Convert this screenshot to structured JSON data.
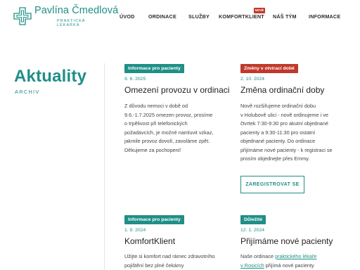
{
  "brand": {
    "name": "Pavlína Čmedlová",
    "subtitle_line1": "Praktická",
    "subtitle_line2": "lékařka",
    "color": "#1f8f87"
  },
  "nav": {
    "items": [
      {
        "label": "Úvod"
      },
      {
        "label": "Ordinace"
      },
      {
        "label": "Služby"
      },
      {
        "label": "KomfortKlient"
      },
      {
        "label": "Náš tým"
      },
      {
        "label": "Informace"
      }
    ],
    "new_badge": "Nové"
  },
  "page": {
    "title": "Aktuality",
    "archive_label": "Archiv"
  },
  "news": [
    {
      "category": "Informace pro pacienty",
      "category_color": "#1f8f87",
      "date": "9. 6. 2025",
      "title": "Omezení provozu v ordinaci",
      "body": [
        "Z důvodu nemoci v době od",
        "9.6.-1.7.2025 omezen provoz, prosíme",
        "o trpělivost při telefonických",
        "požadavcích, je možné namluvit vzkaz,",
        "jakmile provoz dovolí, zavoláme zpět.",
        "Děkujeme za pochopení!"
      ]
    },
    {
      "category": "Změny v otvírací době",
      "category_color": "#c0392b",
      "date": "2. 10. 2024",
      "title": "Změna ordinační doby",
      "body": [
        "Nově rozšiřujeme ordinační dobu",
        "v Holubově ulici - nově ordinujeme i ve",
        "čtvrtek 7:30-9:30 pro akutní objednané",
        "pacienty a 9:30-11:30 pro ostatní",
        "objednané pacienty. Do ordinace",
        "přijímáme nové pacienty - k registraci se",
        "prosím objednejte přes Emmy."
      ],
      "button": "Zaregistrovat se"
    },
    {
      "category": "Informace pro pacienty",
      "category_color": "#1f8f87",
      "date": "1. 9. 2024",
      "title": "KomfortKlient",
      "body": [
        "Užijte si komfort nad rámec zdravotního",
        "pojištění bez plné čekárny"
      ]
    },
    {
      "category": "Důležité",
      "category_color": "#1f8f87",
      "date": "12. 1. 2024",
      "title": "Přijímáme nové pacienty",
      "body_prefix": "Naše ordinace ",
      "body_link": "praktického lékaře",
      "body_line2_link": "v Rosicích",
      "body_line2_rest": " přijímá nové pacienty"
    }
  ]
}
